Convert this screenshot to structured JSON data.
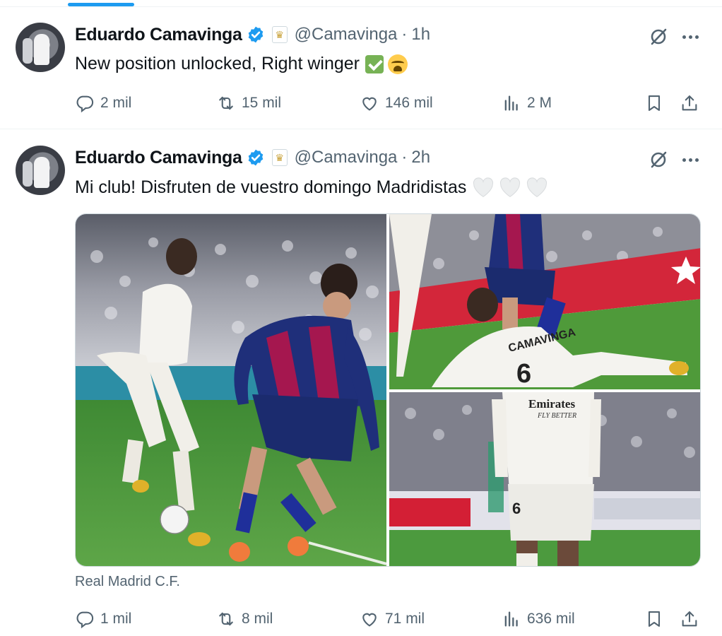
{
  "tweets": [
    {
      "author_name": "Eduardo Camavinga",
      "handle": "@Camavinga",
      "separator": "·",
      "time": "1h",
      "text": "New position unlocked, Right winger",
      "replies": "2 mil",
      "retweets": "15 mil",
      "likes": "146 mil",
      "views": "2 M"
    },
    {
      "author_name": "Eduardo Camavinga",
      "handle": "@Camavinga",
      "separator": "·",
      "time": "2h",
      "text": "Mi club! Disfruten de vuestro domingo Madridistas",
      "media_caption": "Real Madrid C.F.",
      "replies": "1 mil",
      "retweets": "8 mil",
      "likes": "71 mil",
      "views": "636 mil"
    }
  ],
  "photos": {
    "main_shirt_number": "",
    "top_right_shirt_name": "CAMAVINGA",
    "top_right_shirt_number": "6",
    "bottom_right_sponsor": "Emirates",
    "bottom_right_sponsor_sub": "FLY BETTER",
    "bottom_right_shirt_number": "6"
  },
  "icons": [
    "verified-icon",
    "club-badge-icon",
    "grok-icon",
    "more-icon",
    "reply-icon",
    "retweet-icon",
    "like-icon",
    "views-icon",
    "bookmark-icon",
    "share-icon",
    "check-emoji-icon",
    "crying-emoji-icon",
    "white-heart-icon"
  ],
  "colors": {
    "accent": "#1d9bf0",
    "text_primary": "#0f1419",
    "text_secondary": "#536471",
    "border": "#eff3f4",
    "pitch_green": "#4f9a3a",
    "barca_blue": "#1f2f7a",
    "barca_red": "#a5174f"
  }
}
